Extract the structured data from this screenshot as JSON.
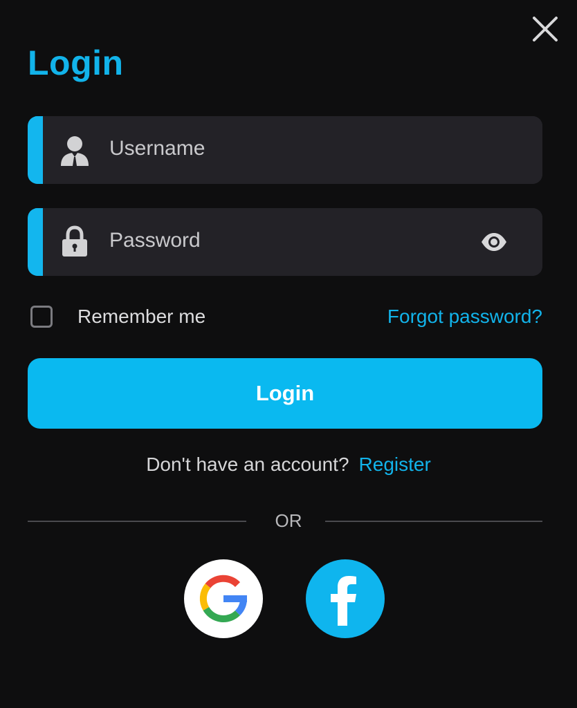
{
  "dialog": {
    "title": "Login",
    "close_icon": "close-icon"
  },
  "form": {
    "username": {
      "placeholder": "Username",
      "icon": "user-icon"
    },
    "password": {
      "placeholder": "Password",
      "icon": "lock-icon",
      "toggle_icon": "eye-icon"
    },
    "remember_label": "Remember me",
    "remember_checked": false,
    "forgot_link": "Forgot password?",
    "submit_label": "Login"
  },
  "register": {
    "prompt": "Don't have an account?",
    "link": "Register"
  },
  "divider_label": "OR",
  "social": [
    {
      "name": "google",
      "icon": "google-icon"
    },
    {
      "name": "facebook",
      "icon": "facebook-icon"
    }
  ],
  "colors": {
    "background": "#0e0e0f",
    "accent": "#12b3ea",
    "field_bg": "#232227",
    "button": "#0ab9f0"
  }
}
